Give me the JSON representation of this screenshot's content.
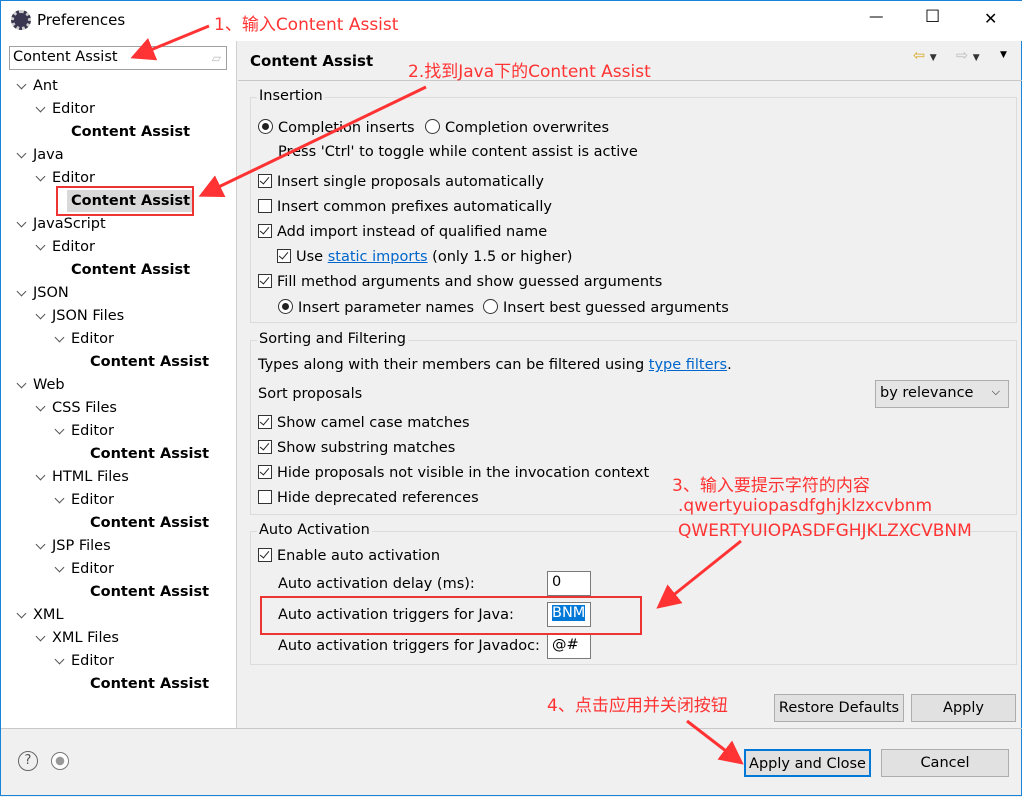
{
  "window": {
    "title": "Preferences",
    "minimize": "—",
    "maximize": "☐",
    "close": "✕"
  },
  "search": {
    "value": "Content Assist"
  },
  "tree": [
    {
      "label": "Ant",
      "level": 0,
      "chev": true
    },
    {
      "label": "Editor",
      "level": 1,
      "chev": true
    },
    {
      "label": "Content Assist",
      "level": 2,
      "leaf": true
    },
    {
      "label": "Java",
      "level": 0,
      "chev": true
    },
    {
      "label": "Editor",
      "level": 1,
      "chev": true
    },
    {
      "label": "Content Assist",
      "level": 2,
      "leaf": true,
      "selected": true
    },
    {
      "label": "JavaScript",
      "level": 0,
      "chev": true
    },
    {
      "label": "Editor",
      "level": 1,
      "chev": true
    },
    {
      "label": "Content Assist",
      "level": 2,
      "leaf": true
    },
    {
      "label": "JSON",
      "level": 0,
      "chev": true
    },
    {
      "label": "JSON Files",
      "level": 1,
      "chev": true
    },
    {
      "label": "Editor",
      "level": 2,
      "chev": true
    },
    {
      "label": "Content Assist",
      "level": 3,
      "leaf": true
    },
    {
      "label": "Web",
      "level": 0,
      "chev": true
    },
    {
      "label": "CSS Files",
      "level": 1,
      "chev": true
    },
    {
      "label": "Editor",
      "level": 2,
      "chev": true
    },
    {
      "label": "Content Assist",
      "level": 3,
      "leaf": true
    },
    {
      "label": "HTML Files",
      "level": 1,
      "chev": true
    },
    {
      "label": "Editor",
      "level": 2,
      "chev": true
    },
    {
      "label": "Content Assist",
      "level": 3,
      "leaf": true
    },
    {
      "label": "JSP Files",
      "level": 1,
      "chev": true
    },
    {
      "label": "Editor",
      "level": 2,
      "chev": true
    },
    {
      "label": "Content Assist",
      "level": 3,
      "leaf": true
    },
    {
      "label": "XML",
      "level": 0,
      "chev": true
    },
    {
      "label": "XML Files",
      "level": 1,
      "chev": true
    },
    {
      "label": "Editor",
      "level": 2,
      "chev": true
    },
    {
      "label": "Content Assist",
      "level": 3,
      "leaf": true
    }
  ],
  "page": {
    "title": "Content Assist"
  },
  "insertion": {
    "label": "Insertion",
    "completion_inserts": "Completion inserts",
    "completion_overwrites": "Completion overwrites",
    "toggle_hint": "Press 'Ctrl' to toggle while content assist is active",
    "single_proposals": "Insert single proposals automatically",
    "common_prefixes": "Insert common prefixes automatically",
    "add_import": "Add import instead of qualified name",
    "use": "Use",
    "static_imports": "static imports",
    "only_15": "(only 1.5 or higher)",
    "fill_method": "Fill method arguments and show guessed arguments",
    "param_names": "Insert parameter names",
    "best_guessed": "Insert best guessed arguments"
  },
  "sorting": {
    "label": "Sorting and Filtering",
    "types_text": "Types along with their members can be filtered using",
    "type_filters": "type filters",
    "period": ".",
    "sort_proposals": "Sort proposals",
    "sort_value": "by relevance",
    "camel_case": "Show camel case matches",
    "substring": "Show substring matches",
    "hide_not_visible": "Hide proposals not visible in the invocation context",
    "hide_deprecated": "Hide deprecated references"
  },
  "auto": {
    "label": "Auto Activation",
    "enable": "Enable auto activation",
    "delay_label": "Auto activation delay (ms):",
    "delay_value": "0",
    "java_label": "Auto activation triggers for Java:",
    "java_value": "BNM",
    "javadoc_label": "Auto activation triggers for Javadoc:",
    "javadoc_value": "@#"
  },
  "buttons": {
    "restore": "Restore Defaults",
    "apply": "Apply",
    "apply_close": "Apply and Close",
    "cancel": "Cancel",
    "help": "?"
  },
  "annotations": {
    "step1": "1、输入Content Assist",
    "step2": "2.找到Java下的Content Assist",
    "step3": "3、输入要提示字符的内容",
    "step3_line1": ".qwertyuiopasdfghjklzxcvbnm",
    "step3_line2": "QWERTYUIOPASDFGHJKLZXCVBNM",
    "step4": "4、点击应用并关闭按钮",
    "color": "#ff3333"
  }
}
